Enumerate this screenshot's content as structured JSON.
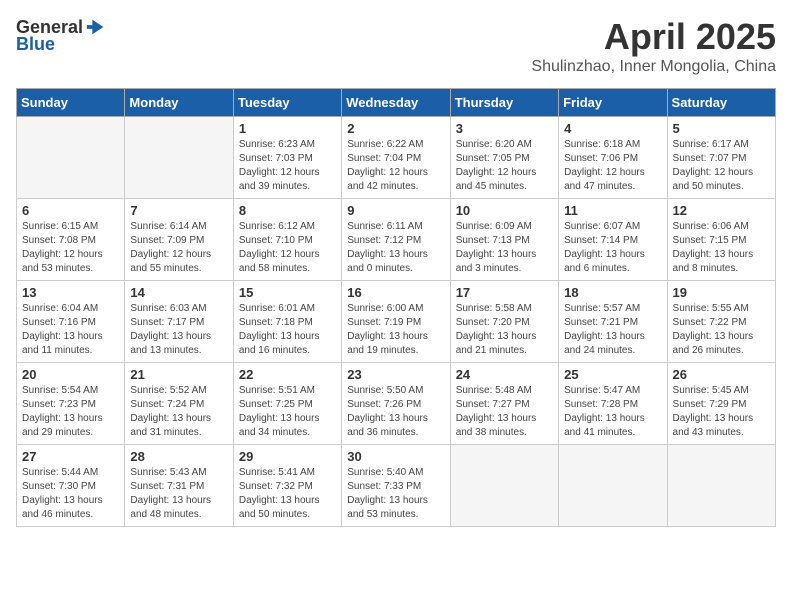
{
  "header": {
    "logo_general": "General",
    "logo_blue": "Blue",
    "title": "April 2025",
    "location": "Shulinzhao, Inner Mongolia, China"
  },
  "weekdays": [
    "Sunday",
    "Monday",
    "Tuesday",
    "Wednesday",
    "Thursday",
    "Friday",
    "Saturday"
  ],
  "weeks": [
    [
      {
        "day": "",
        "detail": ""
      },
      {
        "day": "",
        "detail": ""
      },
      {
        "day": "1",
        "detail": "Sunrise: 6:23 AM\nSunset: 7:03 PM\nDaylight: 12 hours\nand 39 minutes."
      },
      {
        "day": "2",
        "detail": "Sunrise: 6:22 AM\nSunset: 7:04 PM\nDaylight: 12 hours\nand 42 minutes."
      },
      {
        "day": "3",
        "detail": "Sunrise: 6:20 AM\nSunset: 7:05 PM\nDaylight: 12 hours\nand 45 minutes."
      },
      {
        "day": "4",
        "detail": "Sunrise: 6:18 AM\nSunset: 7:06 PM\nDaylight: 12 hours\nand 47 minutes."
      },
      {
        "day": "5",
        "detail": "Sunrise: 6:17 AM\nSunset: 7:07 PM\nDaylight: 12 hours\nand 50 minutes."
      }
    ],
    [
      {
        "day": "6",
        "detail": "Sunrise: 6:15 AM\nSunset: 7:08 PM\nDaylight: 12 hours\nand 53 minutes."
      },
      {
        "day": "7",
        "detail": "Sunrise: 6:14 AM\nSunset: 7:09 PM\nDaylight: 12 hours\nand 55 minutes."
      },
      {
        "day": "8",
        "detail": "Sunrise: 6:12 AM\nSunset: 7:10 PM\nDaylight: 12 hours\nand 58 minutes."
      },
      {
        "day": "9",
        "detail": "Sunrise: 6:11 AM\nSunset: 7:12 PM\nDaylight: 13 hours\nand 0 minutes."
      },
      {
        "day": "10",
        "detail": "Sunrise: 6:09 AM\nSunset: 7:13 PM\nDaylight: 13 hours\nand 3 minutes."
      },
      {
        "day": "11",
        "detail": "Sunrise: 6:07 AM\nSunset: 7:14 PM\nDaylight: 13 hours\nand 6 minutes."
      },
      {
        "day": "12",
        "detail": "Sunrise: 6:06 AM\nSunset: 7:15 PM\nDaylight: 13 hours\nand 8 minutes."
      }
    ],
    [
      {
        "day": "13",
        "detail": "Sunrise: 6:04 AM\nSunset: 7:16 PM\nDaylight: 13 hours\nand 11 minutes."
      },
      {
        "day": "14",
        "detail": "Sunrise: 6:03 AM\nSunset: 7:17 PM\nDaylight: 13 hours\nand 13 minutes."
      },
      {
        "day": "15",
        "detail": "Sunrise: 6:01 AM\nSunset: 7:18 PM\nDaylight: 13 hours\nand 16 minutes."
      },
      {
        "day": "16",
        "detail": "Sunrise: 6:00 AM\nSunset: 7:19 PM\nDaylight: 13 hours\nand 19 minutes."
      },
      {
        "day": "17",
        "detail": "Sunrise: 5:58 AM\nSunset: 7:20 PM\nDaylight: 13 hours\nand 21 minutes."
      },
      {
        "day": "18",
        "detail": "Sunrise: 5:57 AM\nSunset: 7:21 PM\nDaylight: 13 hours\nand 24 minutes."
      },
      {
        "day": "19",
        "detail": "Sunrise: 5:55 AM\nSunset: 7:22 PM\nDaylight: 13 hours\nand 26 minutes."
      }
    ],
    [
      {
        "day": "20",
        "detail": "Sunrise: 5:54 AM\nSunset: 7:23 PM\nDaylight: 13 hours\nand 29 minutes."
      },
      {
        "day": "21",
        "detail": "Sunrise: 5:52 AM\nSunset: 7:24 PM\nDaylight: 13 hours\nand 31 minutes."
      },
      {
        "day": "22",
        "detail": "Sunrise: 5:51 AM\nSunset: 7:25 PM\nDaylight: 13 hours\nand 34 minutes."
      },
      {
        "day": "23",
        "detail": "Sunrise: 5:50 AM\nSunset: 7:26 PM\nDaylight: 13 hours\nand 36 minutes."
      },
      {
        "day": "24",
        "detail": "Sunrise: 5:48 AM\nSunset: 7:27 PM\nDaylight: 13 hours\nand 38 minutes."
      },
      {
        "day": "25",
        "detail": "Sunrise: 5:47 AM\nSunset: 7:28 PM\nDaylight: 13 hours\nand 41 minutes."
      },
      {
        "day": "26",
        "detail": "Sunrise: 5:45 AM\nSunset: 7:29 PM\nDaylight: 13 hours\nand 43 minutes."
      }
    ],
    [
      {
        "day": "27",
        "detail": "Sunrise: 5:44 AM\nSunset: 7:30 PM\nDaylight: 13 hours\nand 46 minutes."
      },
      {
        "day": "28",
        "detail": "Sunrise: 5:43 AM\nSunset: 7:31 PM\nDaylight: 13 hours\nand 48 minutes."
      },
      {
        "day": "29",
        "detail": "Sunrise: 5:41 AM\nSunset: 7:32 PM\nDaylight: 13 hours\nand 50 minutes."
      },
      {
        "day": "30",
        "detail": "Sunrise: 5:40 AM\nSunset: 7:33 PM\nDaylight: 13 hours\nand 53 minutes."
      },
      {
        "day": "",
        "detail": ""
      },
      {
        "day": "",
        "detail": ""
      },
      {
        "day": "",
        "detail": ""
      }
    ]
  ]
}
